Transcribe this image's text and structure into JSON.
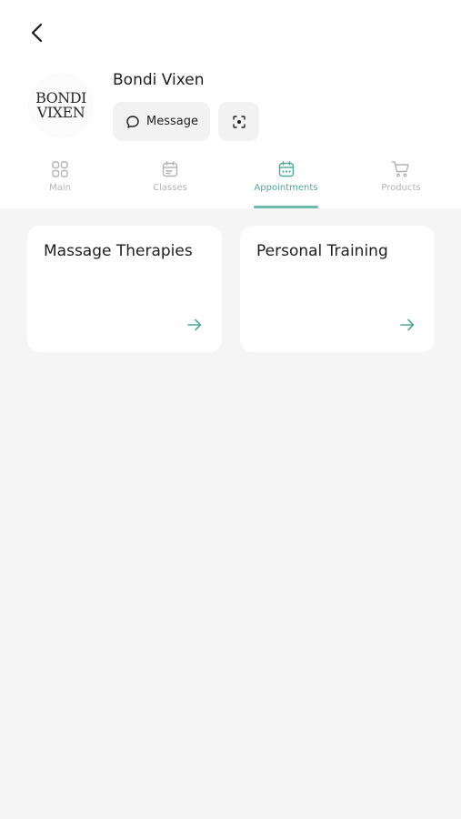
{
  "studio": {
    "name": "Bondi Vixen",
    "logo_line1": "BONDI",
    "logo_line2": "VIXEN"
  },
  "actions": {
    "message_label": "Message"
  },
  "tabs": [
    {
      "label": "Main",
      "icon": "grid-icon",
      "active": false
    },
    {
      "label": "Classes",
      "icon": "calendar-icon",
      "active": false
    },
    {
      "label": "Appointments",
      "icon": "calendar-icon",
      "active": true
    },
    {
      "label": "Products",
      "icon": "cart-icon",
      "active": false
    }
  ],
  "cards": [
    {
      "title": "Massage Therapies"
    },
    {
      "title": "Personal Training"
    }
  ],
  "colors": {
    "accent": "#4fa898",
    "inactive": "#b4b4b4",
    "background": "#f5f5f5"
  }
}
